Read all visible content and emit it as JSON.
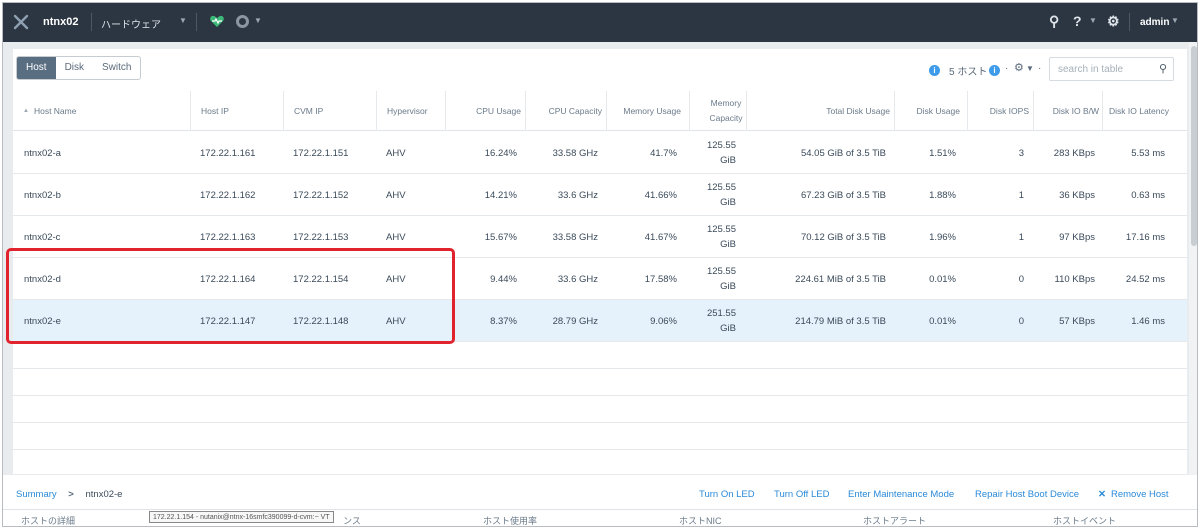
{
  "header": {
    "cluster": "ntnx02",
    "nav": "ハードウェア",
    "user": "admin"
  },
  "tabs": [
    "Host",
    "Disk",
    "Switch"
  ],
  "toolbar": {
    "count_label": "5 ホスト",
    "search_placeholder": "search in table",
    "dash1": "·",
    "dash2": "·"
  },
  "columns": {
    "name": "Host Name",
    "host_ip": "Host IP",
    "cvm_ip": "CVM IP",
    "hypervisor": "Hypervisor",
    "cpu_usage": "CPU Usage",
    "cpu_capacity": "CPU Capacity",
    "memory_usage": "Memory Usage",
    "memory_capacity": "Memory Capacity",
    "total_disk": "Total Disk Usage",
    "disk_usage": "Disk Usage",
    "disk_iops": "Disk IOPS",
    "disk_bw": "Disk IO B/W",
    "disk_latency": "Disk IO Latency"
  },
  "rows": [
    {
      "name": "ntnx02-a",
      "host_ip": "172.22.1.161",
      "cvm_ip": "172.22.1.151",
      "hypervisor": "AHV",
      "cpu_usage": "16.24%",
      "cpu_capacity": "33.58 GHz",
      "memory_usage": "41.7%",
      "mem_cap_1": "125.55",
      "mem_cap_2": "GiB",
      "total_disk": "54.05 GiB of 3.5 TiB",
      "disk_usage": "1.51%",
      "disk_iops": "3",
      "disk_bw": "283 KBps",
      "disk_latency": "5.53 ms"
    },
    {
      "name": "ntnx02-b",
      "host_ip": "172.22.1.162",
      "cvm_ip": "172.22.1.152",
      "hypervisor": "AHV",
      "cpu_usage": "14.21%",
      "cpu_capacity": "33.6 GHz",
      "memory_usage": "41.66%",
      "mem_cap_1": "125.55",
      "mem_cap_2": "GiB",
      "total_disk": "67.23 GiB of 3.5 TiB",
      "disk_usage": "1.88%",
      "disk_iops": "1",
      "disk_bw": "36 KBps",
      "disk_latency": "0.63 ms"
    },
    {
      "name": "ntnx02-c",
      "host_ip": "172.22.1.163",
      "cvm_ip": "172.22.1.153",
      "hypervisor": "AHV",
      "cpu_usage": "15.67%",
      "cpu_capacity": "33.58 GHz",
      "memory_usage": "41.67%",
      "mem_cap_1": "125.55",
      "mem_cap_2": "GiB",
      "total_disk": "70.12 GiB of 3.5 TiB",
      "disk_usage": "1.96%",
      "disk_iops": "1",
      "disk_bw": "97 KBps",
      "disk_latency": "17.16 ms"
    },
    {
      "name": "ntnx02-d",
      "host_ip": "172.22.1.164",
      "cvm_ip": "172.22.1.154",
      "hypervisor": "AHV",
      "cpu_usage": "9.44%",
      "cpu_capacity": "33.6 GHz",
      "memory_usage": "17.58%",
      "mem_cap_1": "125.55",
      "mem_cap_2": "GiB",
      "total_disk": "224.61 MiB of 3.5 TiB",
      "disk_usage": "0.01%",
      "disk_iops": "0",
      "disk_bw": "110 KBps",
      "disk_latency": "24.52 ms"
    },
    {
      "name": "ntnx02-e",
      "host_ip": "172.22.1.147",
      "cvm_ip": "172.22.1.148",
      "hypervisor": "AHV",
      "cpu_usage": "8.37%",
      "cpu_capacity": "28.79 GHz",
      "memory_usage": "9.06%",
      "mem_cap_1": "251.55",
      "mem_cap_2": "GiB",
      "total_disk": "214.79 MiB of 3.5 TiB",
      "disk_usage": "0.01%",
      "disk_iops": "0",
      "disk_bw": "57 KBps",
      "disk_latency": "1.46 ms"
    }
  ],
  "bottom": {
    "summary": "Summary",
    "sep": ">",
    "host": "ntnx02-e",
    "actions": [
      "Turn On LED",
      "Turn Off LED",
      "Enter Maintenance Mode",
      "Repair Host Boot Device",
      "Remove Host"
    ],
    "subtabs": [
      "ホストの詳細",
      "ンス",
      "ホスト使用率",
      "ホストNIC",
      "ホストアラート",
      "ホストイベント"
    ],
    "tooltip": "172.22.1.154 - nutanix@ntnx-16smfc390099-d-cvm:~ VT"
  },
  "colors": {
    "topbar": "#2b3642",
    "accent": "#2a8ad8",
    "highlight": "#e0232c",
    "selected_row": "#e6f2fb"
  }
}
